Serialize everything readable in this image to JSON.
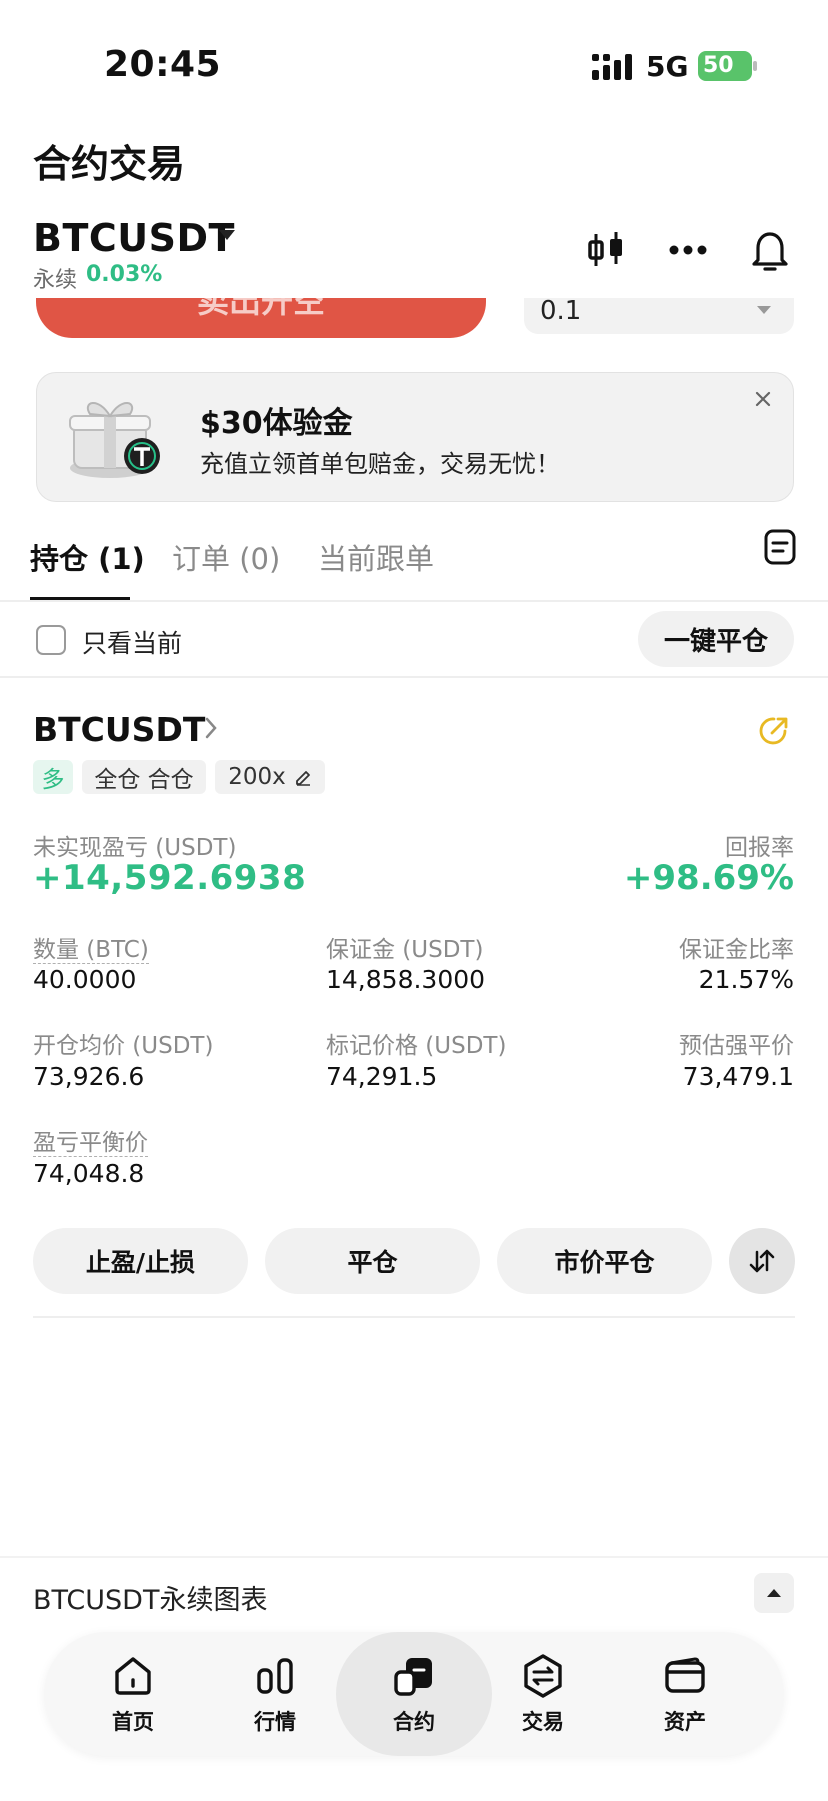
{
  "status_bar": {
    "time": "20:45",
    "network": "5G",
    "battery": "50"
  },
  "page": {
    "title": "合约交易"
  },
  "header": {
    "symbol": "BTCUSDT",
    "perp_label": "永续",
    "change": "0.03%",
    "icons": [
      "candlestick-chart-icon",
      "more-icon",
      "bell-icon"
    ]
  },
  "order_form": {
    "sell_label": "卖出开空",
    "quantity": "0.1"
  },
  "banner": {
    "title": "$30体验金",
    "subtitle": "充值立领首单包赔金，交易无忧！"
  },
  "tabs": [
    {
      "label": "持仓 (1)",
      "active": true
    },
    {
      "label": "订单 (0)",
      "active": false
    },
    {
      "label": "当前跟单",
      "active": false
    }
  ],
  "filter": {
    "only_current_label": "只看当前",
    "close_all_label": "一键平仓"
  },
  "position": {
    "symbol": "BTCUSDT",
    "side": "多",
    "mode": "全仓 合仓",
    "leverage": "200x",
    "pnl_label": "未实现盈亏 (USDT)",
    "pnl_value": "+14,592.6938",
    "roe_label": "回报率",
    "roe_value": "+98.69%",
    "fields": {
      "qty_label": "数量 (BTC)",
      "qty_value": "40.0000",
      "margin_label": "保证金 (USDT)",
      "margin_value": "14,858.3000",
      "margin_ratio_label": "保证金比率",
      "margin_ratio_value": "21.57%",
      "entry_label": "开仓均价 (USDT)",
      "entry_value": "73,926.6",
      "mark_label": "标记价格 (USDT)",
      "mark_value": "74,291.5",
      "liq_label": "预估强平价",
      "liq_value": "73,479.1",
      "breakeven_label": "盈亏平衡价",
      "breakeven_value": "74,048.8"
    },
    "actions": {
      "tpsl": "止盈/止损",
      "close": "平仓",
      "market_close": "市价平仓"
    }
  },
  "chart_bar": {
    "label": "BTCUSDT永续图表"
  },
  "nav": [
    {
      "label": "首页",
      "icon": "home-icon"
    },
    {
      "label": "行情",
      "icon": "market-icon"
    },
    {
      "label": "合约",
      "icon": "futures-icon",
      "active": true
    },
    {
      "label": "交易",
      "icon": "trade-icon"
    },
    {
      "label": "资产",
      "icon": "wallet-icon"
    }
  ],
  "colors": {
    "green": "#2fbd85",
    "red": "#e05545"
  }
}
